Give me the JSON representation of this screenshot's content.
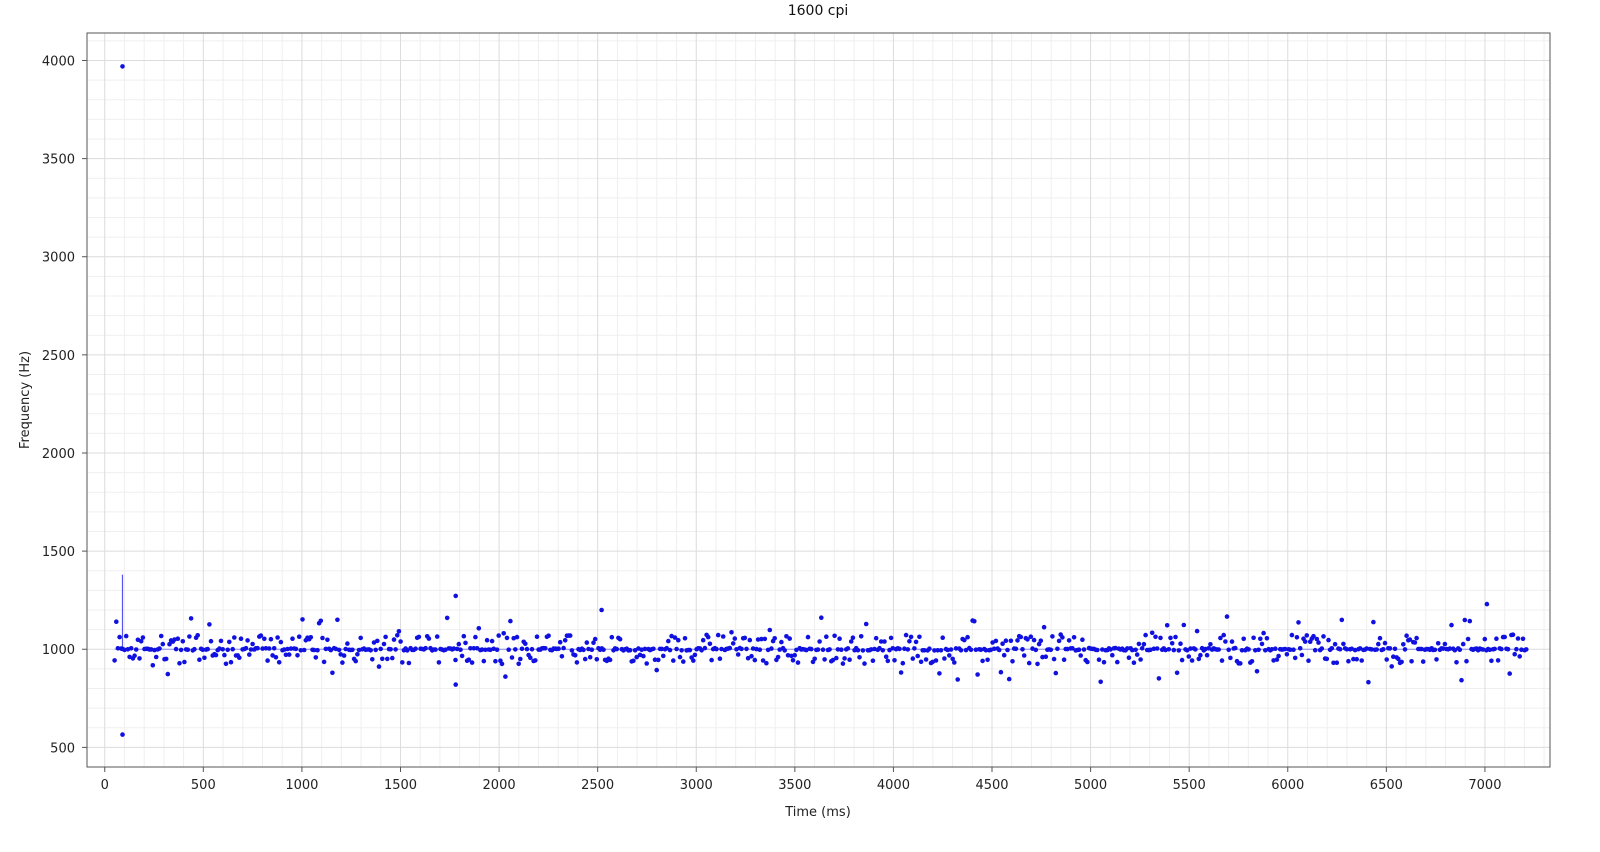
{
  "chart_data": {
    "type": "scatter",
    "title": "1600 cpi",
    "xlabel": "Time (ms)",
    "ylabel": "Frequency (Hz)",
    "xlim": [
      -90,
      7330
    ],
    "ylim": [
      400,
      4140
    ],
    "x_ticks": [
      0,
      500,
      1000,
      1500,
      2000,
      2500,
      3000,
      3500,
      4000,
      4500,
      5000,
      5500,
      6000,
      6500,
      7000
    ],
    "y_ticks": [
      500,
      1000,
      1500,
      2000,
      2500,
      3000,
      3500,
      4000
    ],
    "x_tick_labels": [
      "0",
      "500",
      "1000",
      "1500",
      "2000",
      "2500",
      "3000",
      "3500",
      "4000",
      "4500",
      "5000",
      "5500",
      "6000",
      "6500",
      "7000"
    ],
    "y_tick_labels": [
      "500",
      "1000",
      "1500",
      "2000",
      "2500",
      "3000",
      "3500",
      "4000"
    ],
    "grid": true,
    "marker_color": "#1010e0",
    "line_color": "#5555ee",
    "series": [
      {
        "x_start": 50,
        "x_end": 7210,
        "points": 850,
        "base_value": 1000,
        "note_sampling": "poll at ~1000 Hz, values scatter roughly 880-1170 Hz",
        "outliers": [
          {
            "x": 90,
            "y": 3970
          },
          {
            "x": 90,
            "y": 565
          },
          {
            "x": 1780,
            "y": 1272
          },
          {
            "x": 1780,
            "y": 820
          },
          {
            "x": 2520,
            "y": 1200
          },
          {
            "x": 7010,
            "y": 1230
          },
          {
            "x": 90,
            "y": 1380
          }
        ]
      }
    ]
  }
}
